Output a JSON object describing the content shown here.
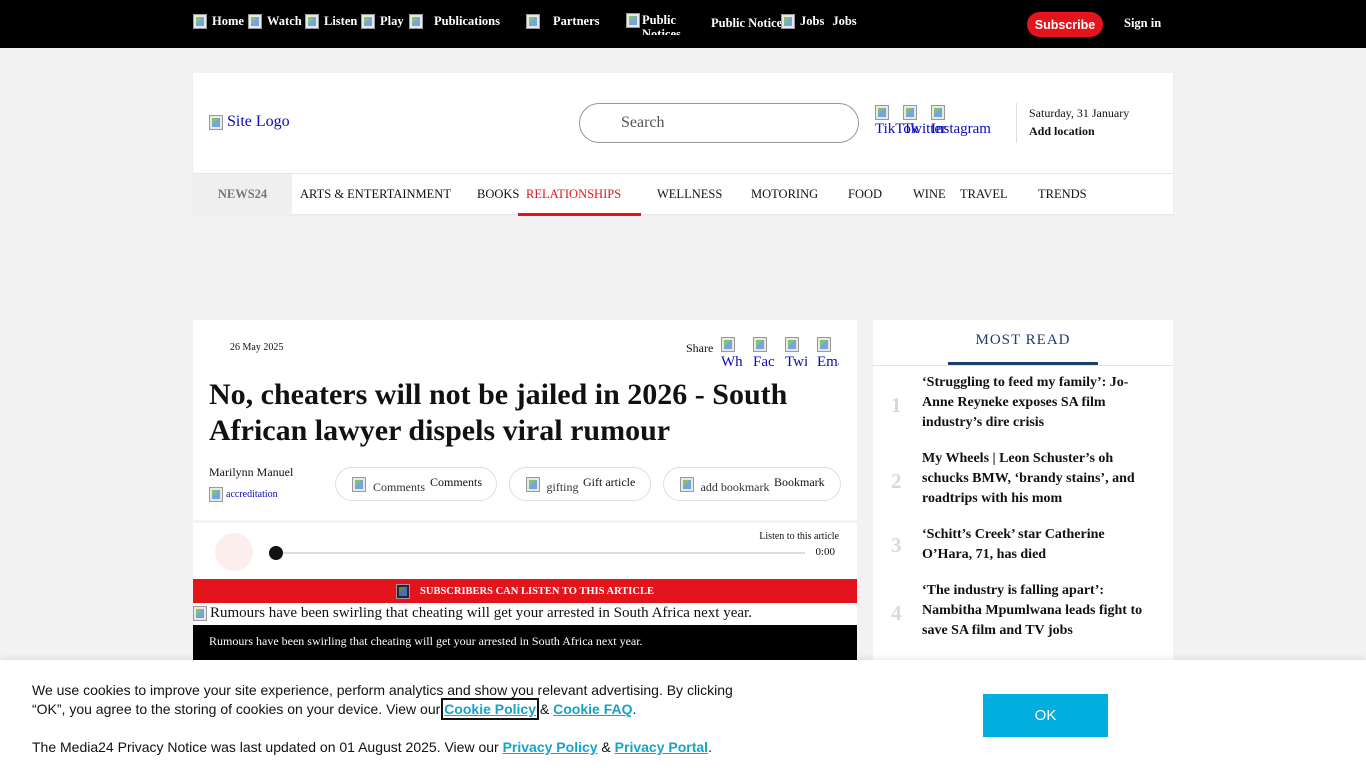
{
  "topnav": {
    "items": [
      {
        "label": "Home",
        "icon": "home-icon"
      },
      {
        "label": "Watch",
        "icon": "watch-icon"
      },
      {
        "label": "Listen",
        "icon": "listen-icon"
      },
      {
        "label": "Play",
        "icon": "play-icon"
      },
      {
        "label": "Publications",
        "icon": "publications-icon"
      },
      {
        "label": "Partners",
        "icon": "partners-icon"
      },
      {
        "label": "Public Notices",
        "icon": "public-notices-icon",
        "img_alt": "Public Notices"
      },
      {
        "label": "Jobs",
        "icon": "jobs-icon",
        "img_alt": "Jobs"
      }
    ],
    "subscribe_label": "Subscribe",
    "signin_label": "Sign in",
    "brand_red": "#e3141b"
  },
  "header": {
    "logo_alt": "Site Logo",
    "search_placeholder": "Search",
    "social": [
      {
        "alt": "TikTok",
        "icon": "tiktok-icon"
      },
      {
        "alt": "Twitter",
        "icon": "twitter-icon"
      },
      {
        "alt": "Instagram",
        "icon": "instagram-icon"
      }
    ],
    "date": "Saturday, 31 January",
    "add_location": "Add location"
  },
  "categories": [
    {
      "label": "NEWS24"
    },
    {
      "label": "ARTS & ENTERTAINMENT"
    },
    {
      "label": "BOOKS"
    },
    {
      "label": "RELATIONSHIPS",
      "active": true
    },
    {
      "label": "WELLNESS"
    },
    {
      "label": "MOTORING"
    },
    {
      "label": "FOOD"
    },
    {
      "label": "WINE"
    },
    {
      "label": "TRAVEL"
    },
    {
      "label": "TRENDS"
    }
  ],
  "article": {
    "date": "26 May 2025",
    "share_label": "Share",
    "share_icons": [
      {
        "alt": "Wh",
        "icon": "whatsapp-icon"
      },
      {
        "alt": "Fac",
        "icon": "facebook-icon"
      },
      {
        "alt": "Twi",
        "icon": "twitter-icon"
      },
      {
        "alt": "Ema",
        "icon": "email-icon"
      }
    ],
    "headline": "No, cheaters will not be jailed in 2026 - South African lawyer dispels viral rumour",
    "author": "Marilynn Manuel",
    "accreditation_alt": "accreditation",
    "buttons": {
      "comments": {
        "alt": "Comments",
        "label": "Comments"
      },
      "gift": {
        "alt": "gifting",
        "label": "Gift article"
      },
      "bookmark": {
        "alt": "add bookmark",
        "label": "Bookmark"
      }
    },
    "audio": {
      "listen_label": "Listen to this article",
      "time": "0:00",
      "progress": 0
    },
    "subscribers_banner": "SUBSCRIBERS CAN LISTEN TO THIS ARTICLE",
    "hero_alt": "Rumours have been swirling that cheating will get your arrested in South Africa next year.",
    "caption": "Rumours have been swirling that cheating will get your arrested in South Africa next year."
  },
  "most_read": {
    "title": "MOST READ",
    "items": [
      {
        "num": "1",
        "text": "‘Struggling to feed my family’: Jo-Anne Reyneke exposes SA film industry’s dire crisis"
      },
      {
        "num": "2",
        "text": "My Wheels | Leon Schuster’s oh schucks BMW, ‘brandy stains’, and roadtrips with his mom"
      },
      {
        "num": "3",
        "text": "‘Schitt’s Creek’ star Catherine O’Hara, 71, has died"
      },
      {
        "num": "4",
        "text": "‘The industry is falling apart’: Nambitha Mpumlwana leads fight to save SA film and TV jobs"
      }
    ]
  },
  "cookie": {
    "text1_a": "We use cookies to improve your site experience, perform analytics and show you relevant advertising. By clicking “OK”, you agree to the storing of cookies on your device. View our ",
    "cookie_policy": "Cookie Policy",
    "amp": " & ",
    "cookie_faq": "Cookie FAQ",
    "period": ".",
    "text2_a": "The Media24 Privacy Notice was last updated on 01 August 2025. View our ",
    "privacy_policy": "Privacy Policy",
    "privacy_portal": "Privacy Portal",
    "ok_label": "OK",
    "accent": "#00aee0"
  }
}
